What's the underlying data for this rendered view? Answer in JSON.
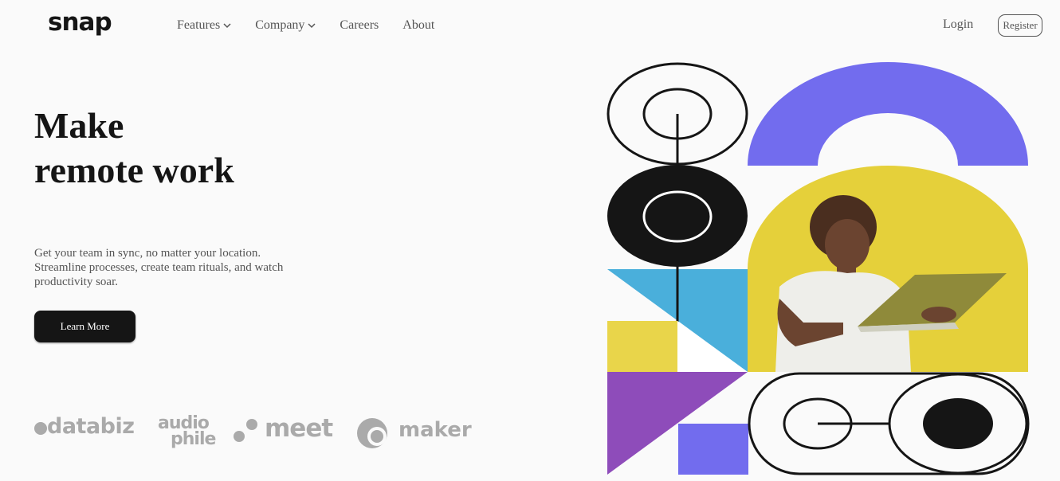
{
  "brand": {
    "logo_text": "snap"
  },
  "nav": {
    "items": [
      {
        "label": "Features",
        "has_dropdown": true
      },
      {
        "label": "Company",
        "has_dropdown": true
      },
      {
        "label": "Careers",
        "has_dropdown": false
      },
      {
        "label": "About",
        "has_dropdown": false
      }
    ],
    "login_label": "Login",
    "register_label": "Register"
  },
  "hero": {
    "headline_line1": "Make",
    "headline_line2": "remote work",
    "description": "Get your team in sync, no matter your location. Streamline processes, create team rituals, and watch productivity soar.",
    "cta_label": "Learn More"
  },
  "clients": {
    "logos": [
      {
        "name": "databiz",
        "text": "databiz"
      },
      {
        "name": "audiophile",
        "line1": "audio",
        "line2": "phile"
      },
      {
        "name": "meet",
        "text": "meet"
      },
      {
        "name": "maker",
        "text": "maker"
      }
    ]
  },
  "colors": {
    "dark": "#151515",
    "muted_text": "#555555",
    "logo_gray": "#aaaaaa",
    "accent_purple": "#726cee",
    "accent_yellow": "#e9d54a",
    "accent_blue": "#4aafdb",
    "accent_violet": "#8e4cba"
  }
}
